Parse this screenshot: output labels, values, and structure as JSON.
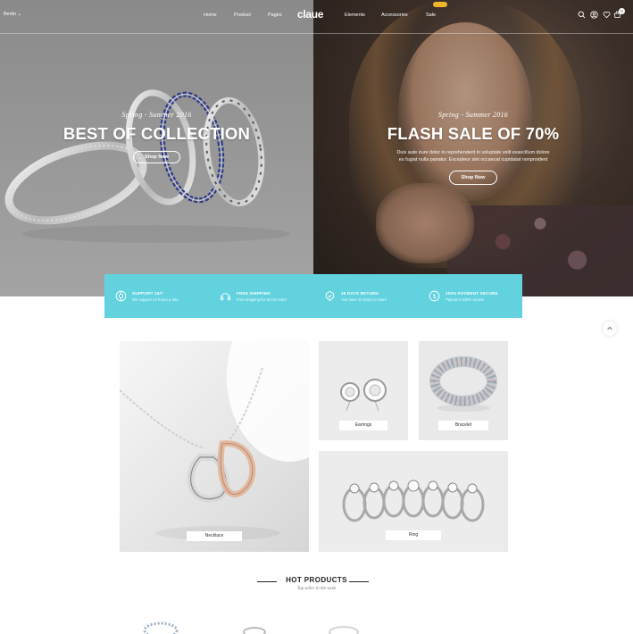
{
  "header": {
    "language": "Berlin",
    "nav_left": [
      "Home",
      "Product",
      "Pages"
    ],
    "logo": "claue",
    "nav_right": [
      "Elements",
      "Accessories",
      "Sale"
    ],
    "icons": [
      "search-icon",
      "user-icon",
      "heart-icon",
      "cart-icon"
    ],
    "cart_count": "0"
  },
  "hero": {
    "left": {
      "season": "Spring - Summer 2016",
      "headline": "BEST OF COLLECTION",
      "button": "Shop Now"
    },
    "right": {
      "season": "Spring - Summer 2016",
      "headline": "FLASH SALE OF 70%",
      "desc_line1": "Duis aute irure dolor in reprehenderit in voluptate velit essecillum dolore",
      "desc_line2": "eu fugiat nulla pariatur. Excepteur sint occaecat cupidatat nonproident",
      "button": "Shop Now"
    }
  },
  "features": [
    {
      "icon": "support-icon",
      "title": "SUPPORT 24/7",
      "subtitle": "We support 24 hours a day"
    },
    {
      "icon": "shipping-icon",
      "title": "FREE SHIPPING",
      "subtitle": "Free shipping for all US order"
    },
    {
      "icon": "return-icon",
      "title": "30 DAYS RETURN",
      "subtitle": "You have 30 days to return"
    },
    {
      "icon": "payment-icon",
      "title": "100% PAYMENT SECURE",
      "subtitle": "Payment 100% secure"
    }
  ],
  "categories": {
    "necklace": "Necklace",
    "earrings": "Earrings",
    "bracelet": "Bracelet",
    "ring": "Ring"
  },
  "hot_products": {
    "title": "HOT PRODUCTS",
    "subtitle": "Top seller in the week"
  },
  "colors": {
    "accent": "#61d2de",
    "badge": "#f0b429"
  }
}
